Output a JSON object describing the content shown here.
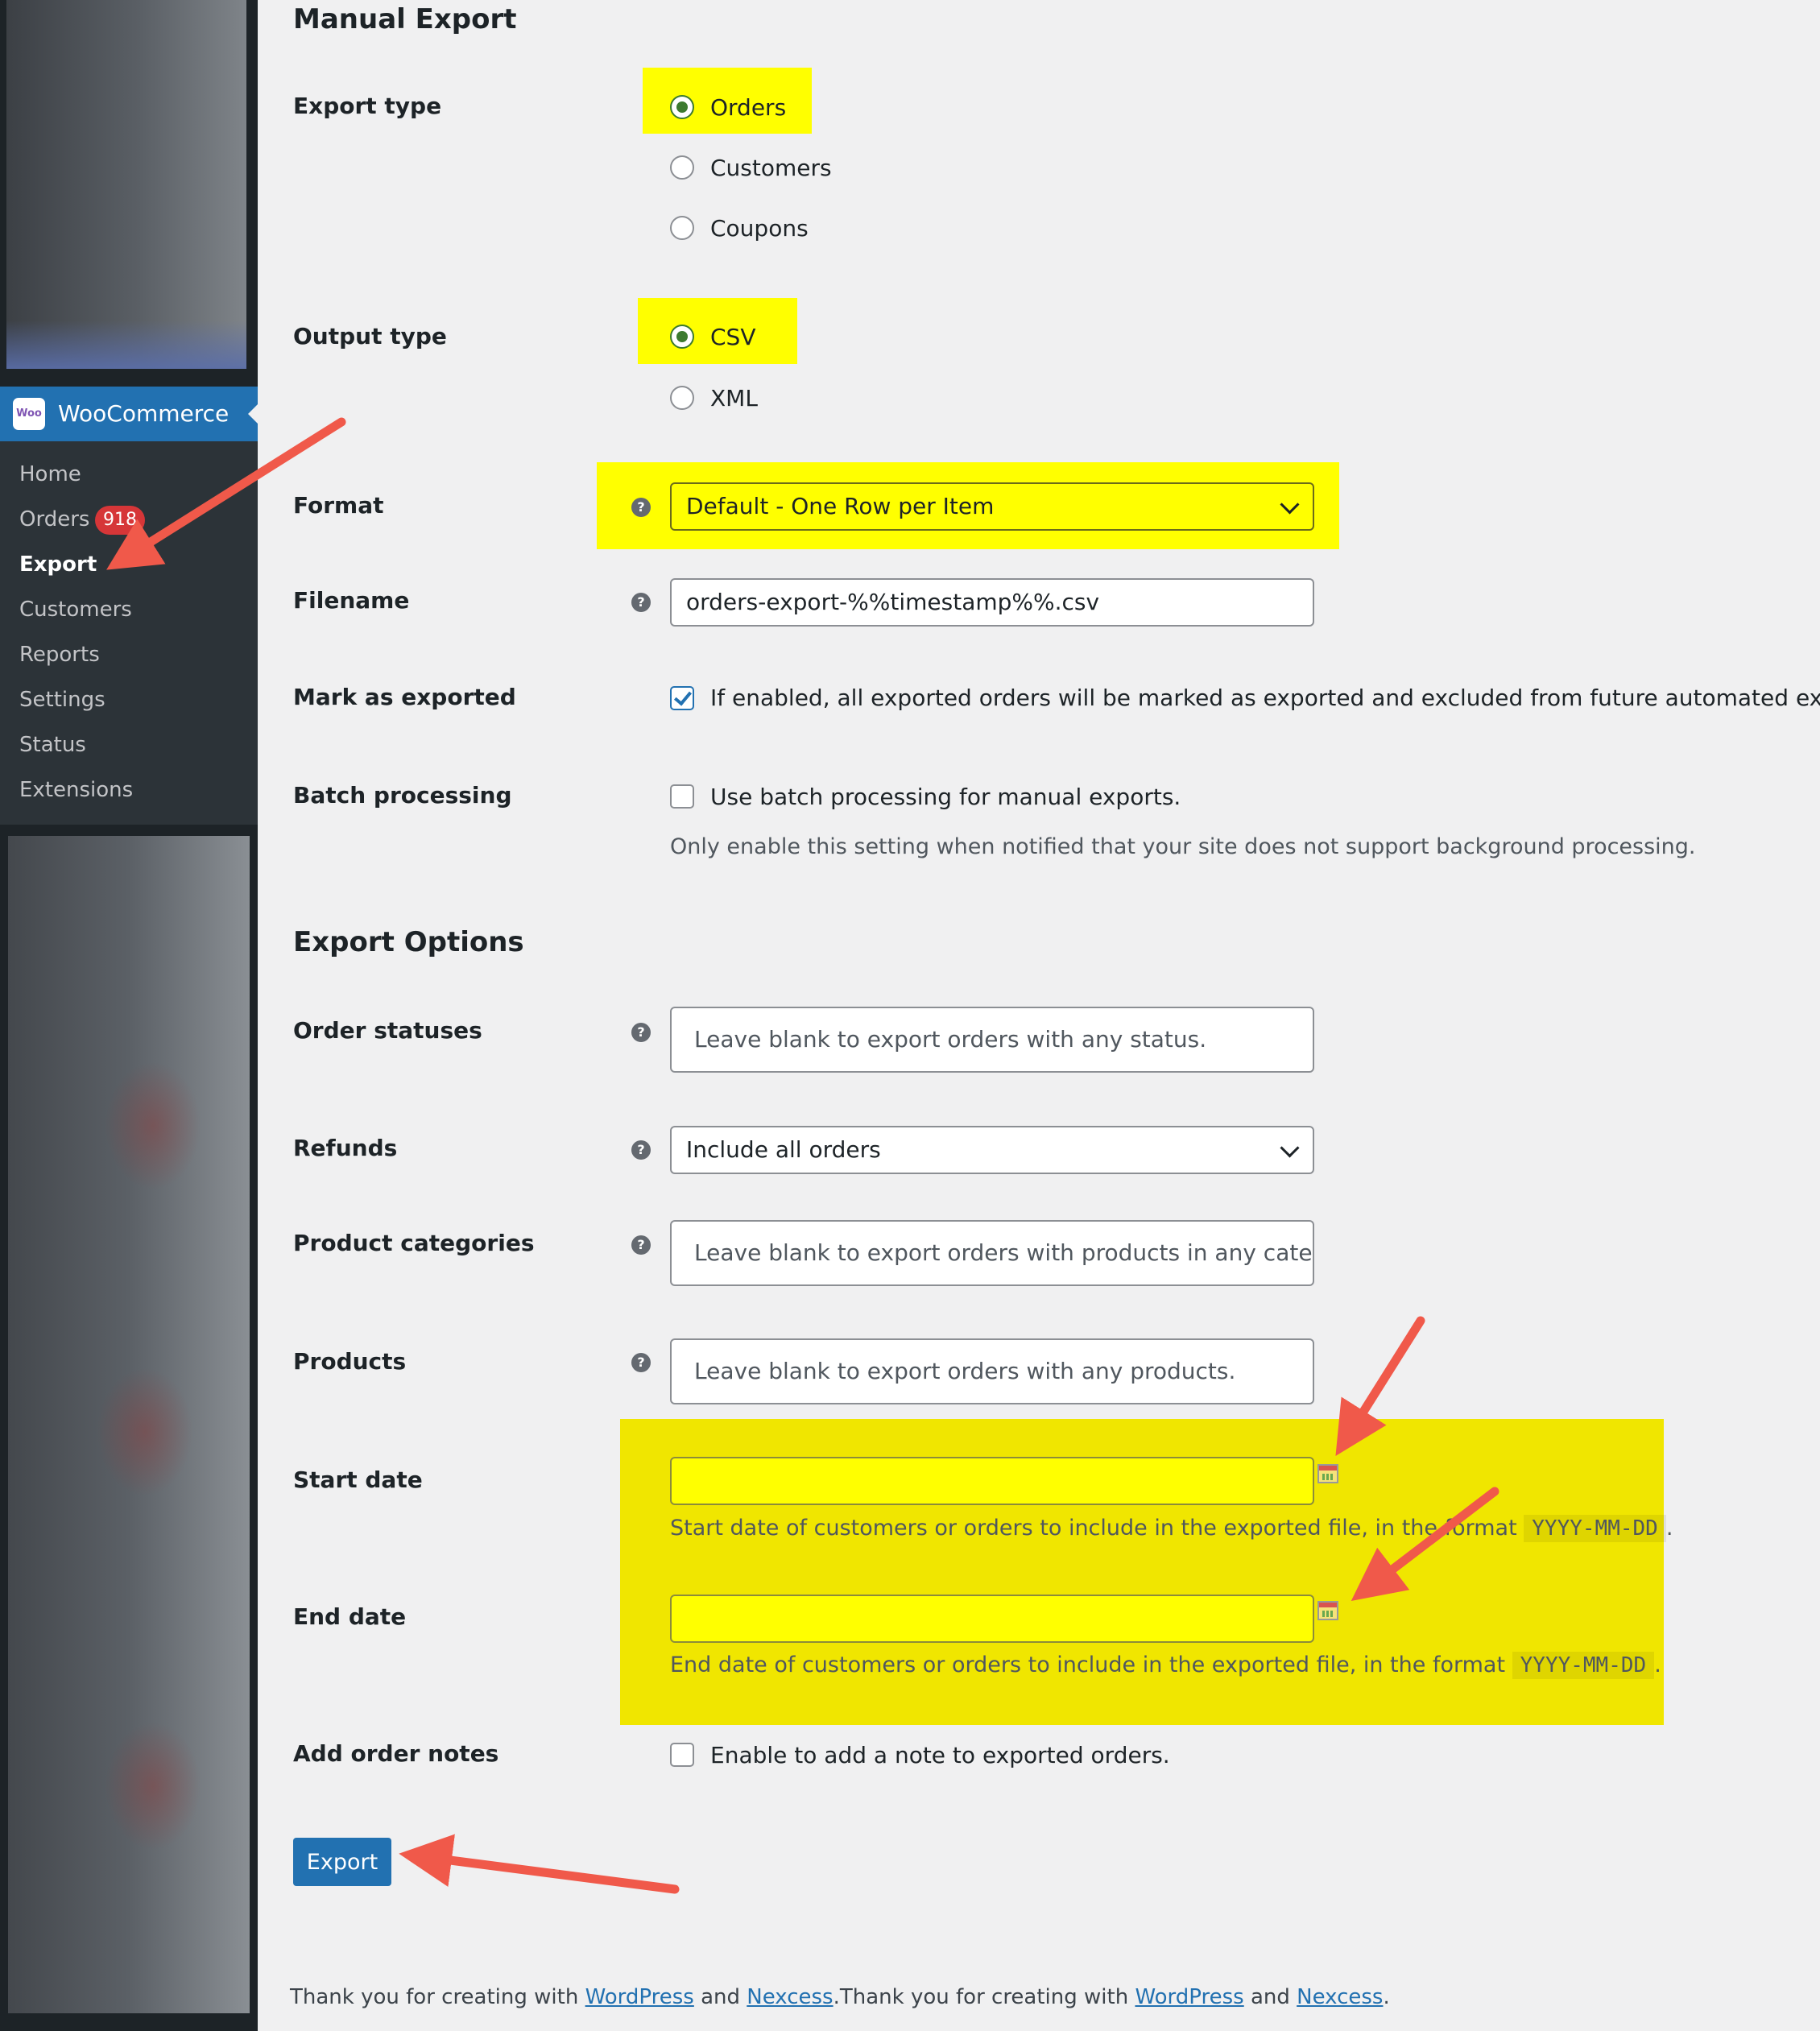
{
  "sidebar": {
    "brand": "WooCommerce",
    "items": [
      {
        "label": "Home"
      },
      {
        "label": "Orders",
        "badge": "918"
      },
      {
        "label": "Export"
      },
      {
        "label": "Customers"
      },
      {
        "label": "Reports"
      },
      {
        "label": "Settings"
      },
      {
        "label": "Status"
      },
      {
        "label": "Extensions"
      }
    ]
  },
  "manual_export": {
    "title": "Manual Export",
    "export_type": {
      "label": "Export type",
      "options": [
        "Orders",
        "Customers",
        "Coupons"
      ],
      "selected": "Orders"
    },
    "output_type": {
      "label": "Output type",
      "options": [
        "CSV",
        "XML"
      ],
      "selected": "CSV"
    },
    "format": {
      "label": "Format",
      "value": "Default - One Row per Item"
    },
    "filename": {
      "label": "Filename",
      "value": "orders-export-%%timestamp%%.csv"
    },
    "mark_as_exported": {
      "label": "Mark as exported",
      "checked": true,
      "text": "If enabled, all exported orders will be marked as exported and excluded from future automated exports."
    },
    "batch_processing": {
      "label": "Batch processing",
      "checked": false,
      "text": "Use batch processing for manual exports.",
      "description": "Only enable this setting when notified that your site does not support background processing."
    }
  },
  "export_options": {
    "title": "Export Options",
    "order_statuses": {
      "label": "Order statuses",
      "placeholder": "Leave blank to export orders with any status."
    },
    "refunds": {
      "label": "Refunds",
      "value": "Include all orders"
    },
    "product_categories": {
      "label": "Product categories",
      "placeholder": "Leave blank to export orders with products in any category."
    },
    "products": {
      "label": "Products",
      "placeholder": "Leave blank to export orders with any products."
    },
    "start_date": {
      "label": "Start date",
      "value": "",
      "description": "Start date of customers or orders to include in the exported file, in the format",
      "format_code": "YYYY-MM-DD",
      "suffix": "."
    },
    "end_date": {
      "label": "End date",
      "value": "",
      "description": "End date of customers or orders to include in the exported file, in the format",
      "format_code": "YYYY-MM-DD",
      "suffix": "."
    },
    "add_order_notes": {
      "label": "Add order notes",
      "checked": false,
      "text": "Enable to add a note to exported orders."
    }
  },
  "actions": {
    "export_label": "Export"
  },
  "footer": {
    "prefix": "Thank you for creating with ",
    "link1": "WordPress",
    "and": " and ",
    "link2": "Nexcess",
    "suffix": "."
  },
  "colors": {
    "highlight": "#ffff00",
    "annotation_arrow": "#f0594a",
    "primary": "#2271b1",
    "sidebar": "#1d2327"
  }
}
